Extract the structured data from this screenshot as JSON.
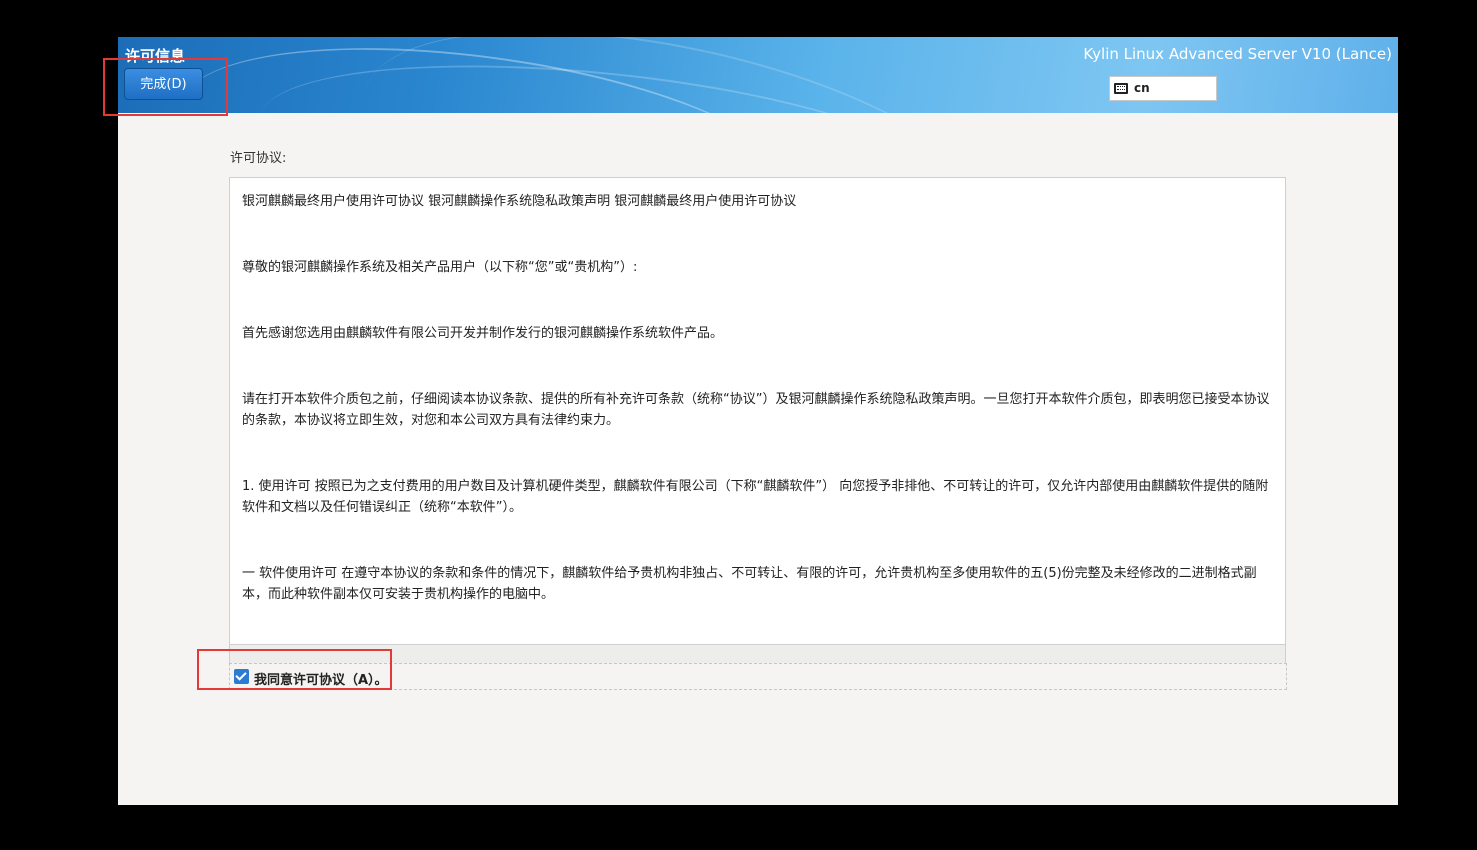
{
  "header": {
    "title": "许可信息",
    "done_button": "完成(D)",
    "product": "Kylin Linux Advanced Server V10 (Lance)",
    "keyboard_layout": "cn",
    "keyboard_icon": "keyboard-icon"
  },
  "license": {
    "label": "许可协议:",
    "paragraphs": [
      "银河麒麟最终用户使用许可协议 银河麒麟操作系统隐私政策声明 银河麒麟最终用户使用许可协议",
      " 尊敬的银河麒麟操作系统及相关产品用户（以下称“您”或“贵机构”）:",
      " 首先感谢您选用由麒麟软件有限公司开发并制作发行的银河麒麟操作系统软件产品。",
      " 请在打开本软件介质包之前，仔细阅读本协议条款、提供的所有补充许可条款（统称“协议”）及银河麒麟操作系统隐私政策声明。一旦您打开本软件介质包，即表明您已接受本协议的条款，本协议将立即生效，对您和本公司双方具有法律约束力。",
      " 1. 使用许可 按照已为之支付费用的用户数目及计算机硬件类型，麒麟软件有限公司（下称“麒麟软件”） 向您授予非排他、不可转让的许可，仅允许内部使用由麒麟软件提供的随附软件和文档以及任何错误纠正（统称“本软件”）。",
      " 一 软件使用许可 在遵守本协议的条款和条件的情况下，麒麟软件给予贵机构非独占、不可转让、有限的许可，允许贵机构至多使用软件的五(5)份完整及未经修改的二进制格式副本，而此种软件副本仅可安装于贵机构操作的电脑中。"
    ]
  },
  "agree": {
    "checked": true,
    "label": "我同意许可协议（A）。"
  },
  "colors": {
    "highlight": "#e53935",
    "accent": "#2d7bd1"
  }
}
